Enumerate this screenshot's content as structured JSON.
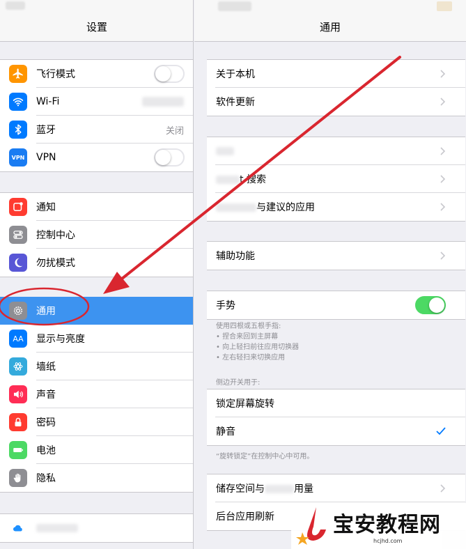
{
  "left": {
    "title": "设置",
    "group1": [
      {
        "label": "飞行模式",
        "icon": "airplane-icon",
        "color": "#ff9500",
        "toggle": false
      },
      {
        "label": "Wi-Fi",
        "icon": "wifi-icon",
        "color": "#007aff"
      },
      {
        "label": "蓝牙",
        "icon": "bluetooth-icon",
        "color": "#007aff",
        "value": "关闭"
      },
      {
        "label": "VPN",
        "icon": "vpn-icon",
        "color": "#1a7cf2",
        "icon_text": "VPN",
        "toggle": false
      }
    ],
    "group2": [
      {
        "label": "通知",
        "icon": "notifications-icon",
        "color": "#ff3b30"
      },
      {
        "label": "控制中心",
        "icon": "control-center-icon",
        "color": "#8e8e93"
      },
      {
        "label": "勿扰模式",
        "icon": "moon-icon",
        "color": "#5856d6"
      }
    ],
    "group3": [
      {
        "label": "通用",
        "icon": "gear-icon",
        "color": "#8e8e93",
        "selected": true
      },
      {
        "label": "显示与亮度",
        "icon": "display-icon",
        "color": "#007aff",
        "icon_text": "AA"
      },
      {
        "label": "墙纸",
        "icon": "wallpaper-icon",
        "color": "#34aadc"
      },
      {
        "label": "声音",
        "icon": "speaker-icon",
        "color": "#ff2d55"
      },
      {
        "label": "密码",
        "icon": "lock-icon",
        "color": "#ff3b30"
      },
      {
        "label": "电池",
        "icon": "battery-icon",
        "color": "#4cd964"
      },
      {
        "label": "隐私",
        "icon": "hand-icon",
        "color": "#8e8e93"
      }
    ],
    "group4": [
      {
        "label": "",
        "icon": "icloud-icon",
        "color": "#1e90ff"
      }
    ]
  },
  "right": {
    "title": "通用",
    "group1": [
      {
        "label": "关于本机"
      },
      {
        "label": "软件更新"
      }
    ],
    "group2": [
      {
        "label": ""
      },
      {
        "label": "t 搜索"
      },
      {
        "label": "与建议的应用"
      }
    ],
    "group3": [
      {
        "label": "辅助功能"
      }
    ],
    "gesture": {
      "label": "手势",
      "toggle": true
    },
    "gesture_note": "使用四根或五根手指:\n• 捏合来回到主屏幕\n• 向上轻扫前往应用切换器\n• 左右轻扫来切换应用",
    "side_switch_header": "侧边开关用于:",
    "side_switch": [
      {
        "label": "锁定屏幕旋转",
        "checked": false
      },
      {
        "label": "静音",
        "checked": true
      }
    ],
    "side_switch_note": "“旋转锁定”在控制中心中可用。",
    "group5": [
      {
        "label_pre": "储存空间与",
        "label_post": "用量"
      },
      {
        "label": "后台应用刷新"
      }
    ]
  },
  "watermark": {
    "title": "宝安教程网",
    "url": "hcjhd.com"
  },
  "colors": {
    "selected_row": "#3d93f0",
    "annotation_red": "#d9262f",
    "toggle_on": "#4cd964",
    "check": "#007aff"
  }
}
